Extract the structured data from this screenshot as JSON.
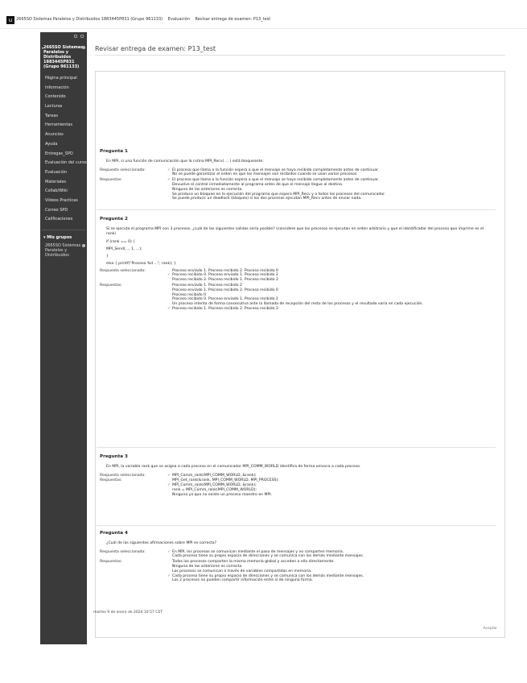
{
  "app": {
    "logo_text": "u",
    "breadcrumbs": [
      "2665SO Sistemas Paralelos y Distribuidos 1883445P831 (Grupo 961133)",
      "Evaluación",
      "Revisar entrega de examen: P13_test"
    ]
  },
  "sidebar": {
    "course_name": "2665SO Sistemas Paralelos y Distribuidos 1883445P831 (Grupo 961133)",
    "items": [
      {
        "label": "Página principal"
      },
      {
        "label": "Información"
      },
      {
        "label": "Contenido"
      },
      {
        "label": "Lecturas"
      },
      {
        "label": "Tareas"
      },
      {
        "label": "Herramientas"
      },
      {
        "label": "Anuncios"
      },
      {
        "label": "Ayuda"
      },
      {
        "label": "Entregas_SPD"
      },
      {
        "label": "Evaluación del curso"
      },
      {
        "label": "Evaluación"
      },
      {
        "label": "Materiales"
      },
      {
        "label": "Collab/Wiki"
      },
      {
        "label": "Vídeos Practicas"
      },
      {
        "label": "Correo SPD"
      },
      {
        "label": "Calificaciones"
      }
    ],
    "groups_title": "Mis grupos",
    "group_name": "2665SO Sistemas Paralelos y Distribuidos"
  },
  "main": {
    "page_title": "Revisar entrega de examen: P13_test",
    "questions": [
      {
        "title": "Pregunta 1",
        "text": "En MPI, si una función de comunicación que la rutina MPI_Recv( ... ) está bloqueante:",
        "selected_label": "Respuesta seleccionada:",
        "selected_options": [
          {
            "mark": "✓",
            "text": "El proceso que llama a la función espera a que el mensaje se haya recibido completamente antes de continuar."
          },
          {
            "mark": "",
            "text": "No se puede garantizar el orden en que los mensajes son recibidos cuando se usan varios procesos."
          }
        ],
        "answers_label": "Respuestas:",
        "answers": [
          {
            "mark": "✓",
            "text": "El proceso que llama a la función espera a que el mensaje se haya recibido completamente antes de continuar."
          },
          {
            "mark": "",
            "text": "Devuelve el control inmediatamente al programa antes de que el mensaje llegue al destino."
          },
          {
            "mark": "",
            "text": "Ninguna de las anteriores es correcta."
          },
          {
            "mark": "",
            "text": "Se produce un bloqueo en la ejecución del programa que espera MPI_Recv y a todos los procesos del comunicador."
          },
          {
            "mark": "",
            "text": "Se puede producir un deadlock (bloqueo) si los dos procesos ejecutan MPI_Recv antes de enviar nada."
          }
        ]
      },
      {
        "title": "Pregunta 2",
        "text": "Si se ejecuta el programa MPI con 3 procesos, ¿cuál de las siguientes salidas sería posible? (considere que los procesos se ejecutan en orden arbitrario y que el identificador del proceso que imprime es el rank)",
        "code": [
          "if (rank == 0) {",
          "    MPI_Send(..., 1, ...);",
          "}",
          "else { printf(\"Proceso %d ...\", rank); }"
        ],
        "selected_label": "Respuesta seleccionada:",
        "selected_options": [
          {
            "mark": "",
            "text": "Proceso enviado 1. Proceso recibido 2. Proceso recibido 0"
          },
          {
            "mark": "✓",
            "text": "Proceso recibido 0. Proceso enviado 1. Proceso recibido 2"
          },
          {
            "mark": "",
            "text": "Proceso recibido 2. Proceso recibido 1. Proceso recibido 2"
          }
        ],
        "answers_label": "Respuestas:",
        "answers": [
          {
            "mark": "",
            "text": "Proceso enviado 1. Proceso recibido 2"
          },
          {
            "mark": "",
            "text": "Proceso enviado 1. Proceso recibido 2. Proceso recibido 0"
          },
          {
            "mark": "",
            "text": "Proceso recibido 0"
          },
          {
            "mark": "",
            "text": "Proceso recibido 0. Proceso enviado 1. Proceso recibido 2"
          },
          {
            "mark": "",
            "text": "Un proceso intenta de forma consecutiva ante la llamada de recepción del resto de los procesos y el resultado varía en cada ejecución."
          },
          {
            "mark": "✓",
            "text": "Proceso recibido 1. Proceso recibido 2. Proceso recibido 2"
          }
        ]
      },
      {
        "title": "Pregunta 3",
        "text": "En MPI, la variable rank que se asigna a cada proceso en el comunicador MPI_COMM_WORLD identifica de forma unívoca a cada proceso.",
        "selected_label": "Respuesta seleccionada:",
        "selected_options": [
          {
            "mark": "✓",
            "text": "MPI_Comm_rank(MPI_COMM_WORLD, &rank);"
          }
        ],
        "answers_label": "Respuestas:",
        "answers": [
          {
            "mark": "",
            "text": "MPI_Get_rank(&rank, MPI_COMM_WORLD, MPI_PROCESS);"
          },
          {
            "mark": "✓",
            "text": "MPI_Comm_rank(MPI_COMM_WORLD, &rank);"
          },
          {
            "mark": "",
            "text": "rank = MPI_Comm_rank(MPI_COMM_WORLD);"
          },
          {
            "mark": "",
            "text": "Ninguna ya que no existe un proceso maestro en MPI."
          }
        ]
      },
      {
        "title": "Pregunta 4",
        "text": "¿Cuál de las siguientes afirmaciones sobre MPI es correcta?",
        "selected_label": "Respuesta seleccionada:",
        "selected_options": [
          {
            "mark": "✓",
            "text": "En MPI, los procesos se comunican mediante el paso de mensajes y no comparten memoria."
          },
          {
            "mark": "",
            "text": "Cada proceso tiene su propio espacio de direcciones y se comunica con los demás mediante mensajes."
          }
        ],
        "answers_label": "Respuestas:",
        "answers": [
          {
            "mark": "",
            "text": "Todos los procesos comparten la misma memoria global y acceden a ella directamente."
          },
          {
            "mark": "",
            "text": "Ninguna de las anteriores es correcta."
          },
          {
            "mark": "",
            "text": "Los procesos se comunican a través de variables compartidas en memoria."
          },
          {
            "mark": "✓",
            "text": "Cada proceso tiene su propio espacio de direcciones y se comunica con los demás mediante mensajes."
          },
          {
            "mark": "",
            "text": "Los 2 procesos no pueden compartir información entre sí de ninguna forma."
          }
        ]
      }
    ],
    "timestamp": "martes 9 de enero de 2024 10:57 CET",
    "ok_label": "Aceptar"
  }
}
